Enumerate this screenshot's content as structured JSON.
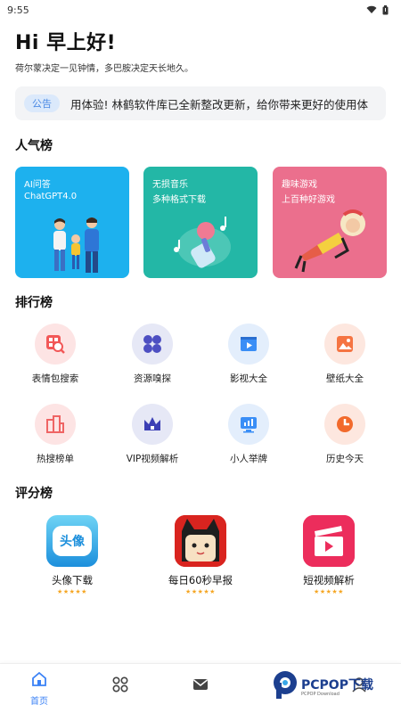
{
  "status_bar": {
    "time": "9:55"
  },
  "header": {
    "greeting": "Hi 早上好!",
    "subtitle": "荷尔蒙决定一见钟情，多巴胺决定天长地久。"
  },
  "notice": {
    "tag": "公告",
    "text": "用体验!   林鹤软件库已全新整改更新，给你带来更好的使用体"
  },
  "popular": {
    "title": "人气榜",
    "cards": [
      {
        "line1": "AI问答",
        "line2": "ChatGPT4.0",
        "color": "#1db1ee"
      },
      {
        "line1": "无损音乐",
        "line2": "多种格式下载",
        "color": "#23b7a6"
      },
      {
        "line1": "趣味游戏",
        "line2": "上百种好游戏",
        "color": "#eb6f8d"
      }
    ]
  },
  "ranking": {
    "title": "排行榜",
    "items": [
      {
        "label": "表情包搜索",
        "icon": "emoji-search-icon",
        "color": "#f25757"
      },
      {
        "label": "资源嗅探",
        "icon": "clover-icon",
        "color": "#4d4fc2"
      },
      {
        "label": "影视大全",
        "icon": "video-play-icon",
        "color": "#3a8ef6"
      },
      {
        "label": "壁纸大全",
        "icon": "picture-icon",
        "color": "#f57442"
      },
      {
        "label": "热搜榜单",
        "icon": "buildings-icon",
        "color": "#ef6464"
      },
      {
        "label": "VIP视频解析",
        "icon": "crown-icon",
        "color": "#3b3fb5"
      },
      {
        "label": "小人举牌",
        "icon": "monitor-chart-icon",
        "color": "#3a8ef6"
      },
      {
        "label": "历史今天",
        "icon": "clock-icon",
        "color": "#f26a2c"
      }
    ]
  },
  "rating": {
    "title": "评分榜",
    "apps": [
      {
        "name": "头像下载",
        "icon_text": "头像",
        "stars": "★★★★★"
      },
      {
        "name": "每日60秒早报",
        "stars": "★★★★★"
      },
      {
        "name": "短视频解析",
        "stars": "★★★★★"
      }
    ]
  },
  "bottom_nav": {
    "home_label": "首页"
  },
  "watermark": {
    "text": "PCPOP下载",
    "sub": "PCPOP Download"
  }
}
